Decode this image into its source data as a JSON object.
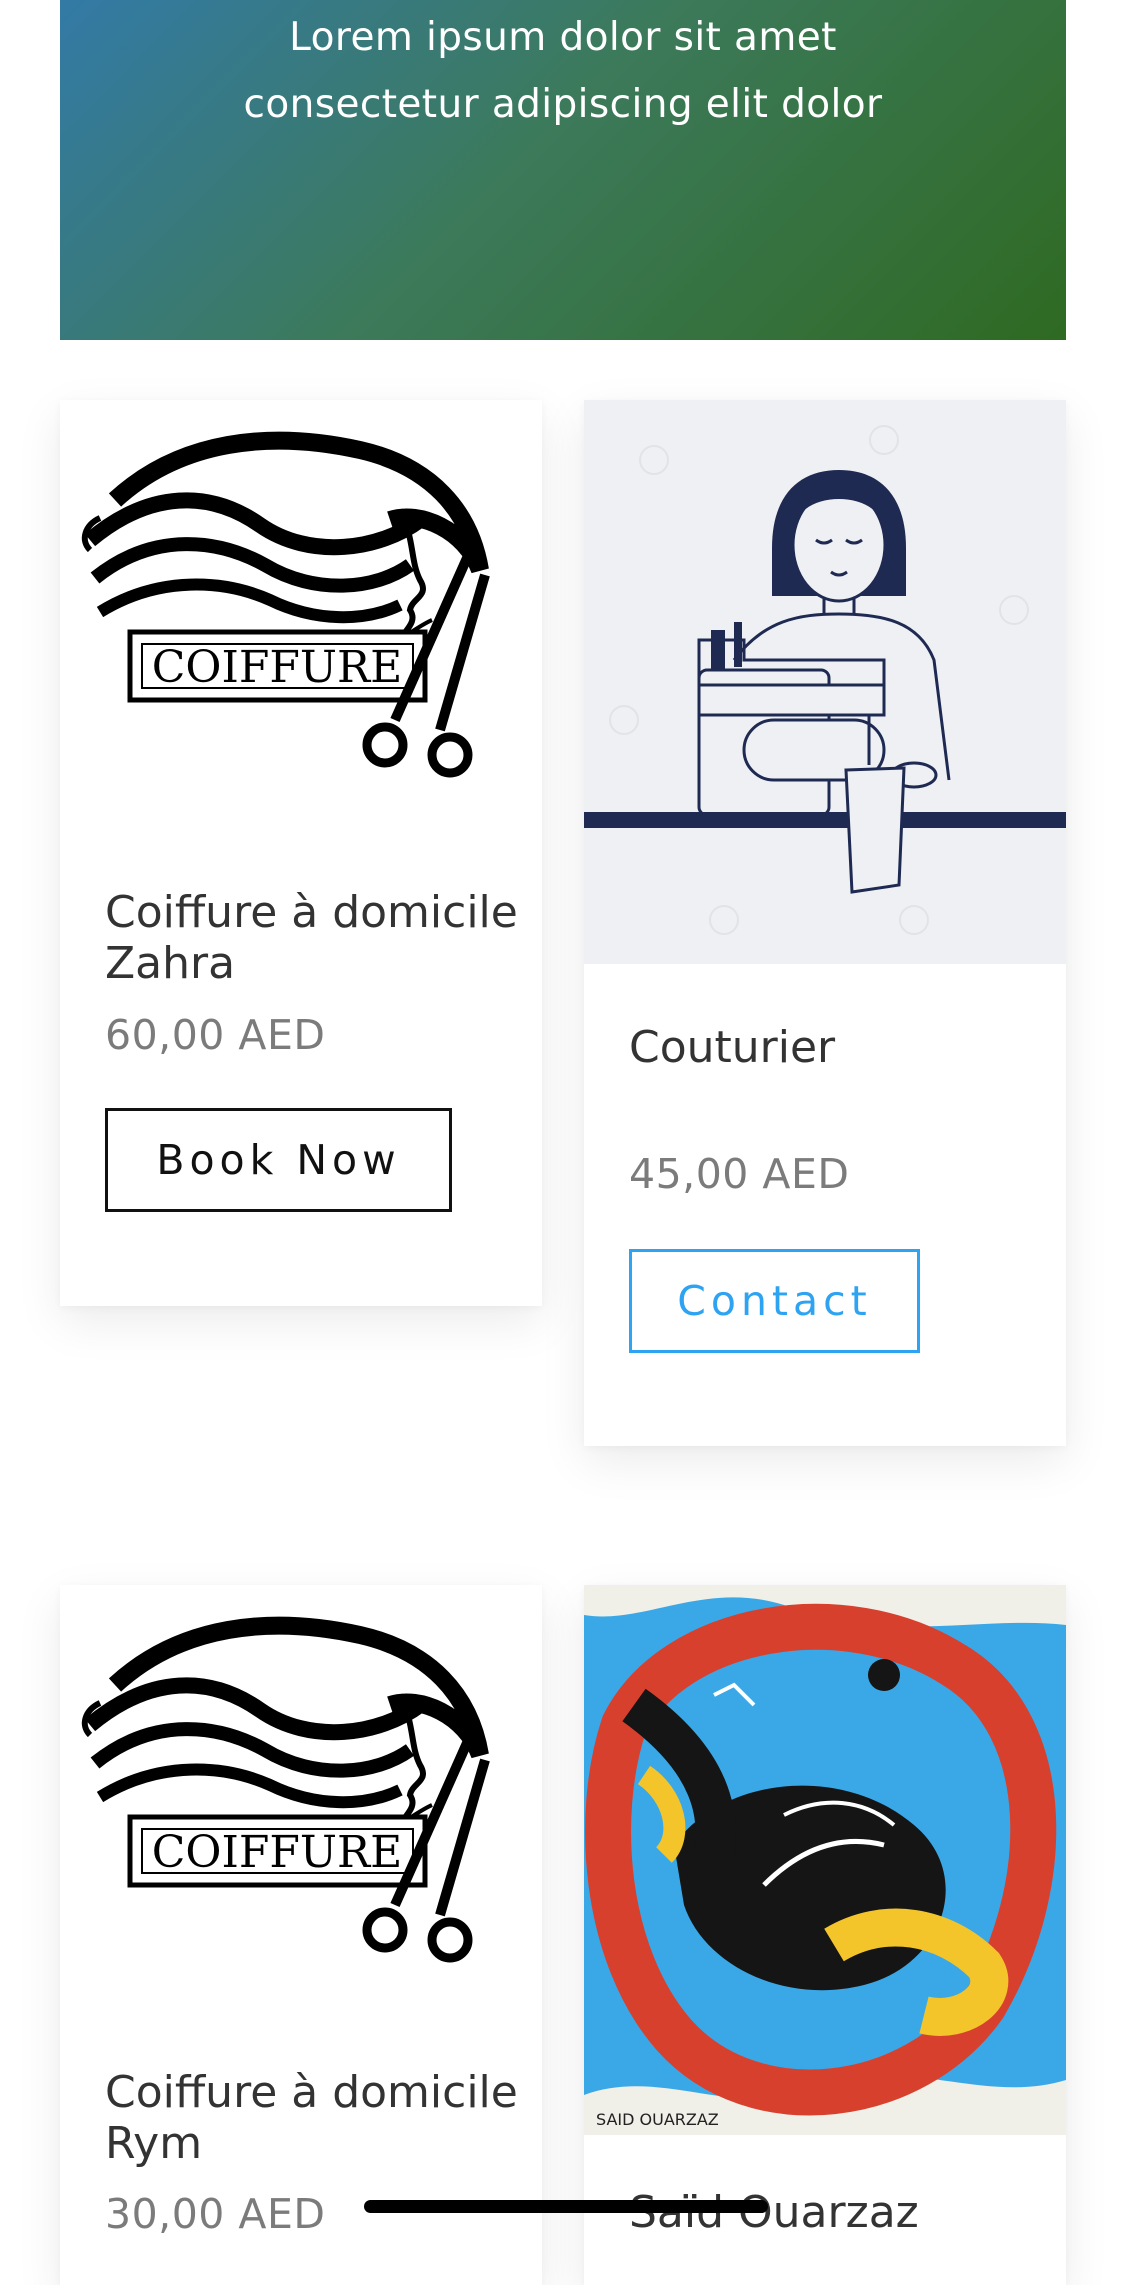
{
  "hero": {
    "line1": "Lorem ipsum dolor sit amet",
    "line2": "consectetur adipiscing elit dolor"
  },
  "products": [
    {
      "image_label": "COIFFURE",
      "title": "Coiffure à domicile Zahra",
      "price": "60,00 AED",
      "button": "Book Now"
    },
    {
      "image_label": "",
      "title": "Couturier",
      "price": "45,00 AED",
      "button": "Contact"
    },
    {
      "image_label": "COIFFURE",
      "title": "Coiffure à domicile Rym",
      "price": "30,00 AED",
      "button": ""
    },
    {
      "image_label": "SAID OUARZAZ",
      "title": "Saïd Ouarzaz",
      "price": "",
      "button": ""
    }
  ],
  "colors": {
    "accent_blue": "#2ea3f2",
    "navy": "#1f2a52",
    "hero_start": "#337aa6",
    "hero_end": "#2f6a22"
  }
}
